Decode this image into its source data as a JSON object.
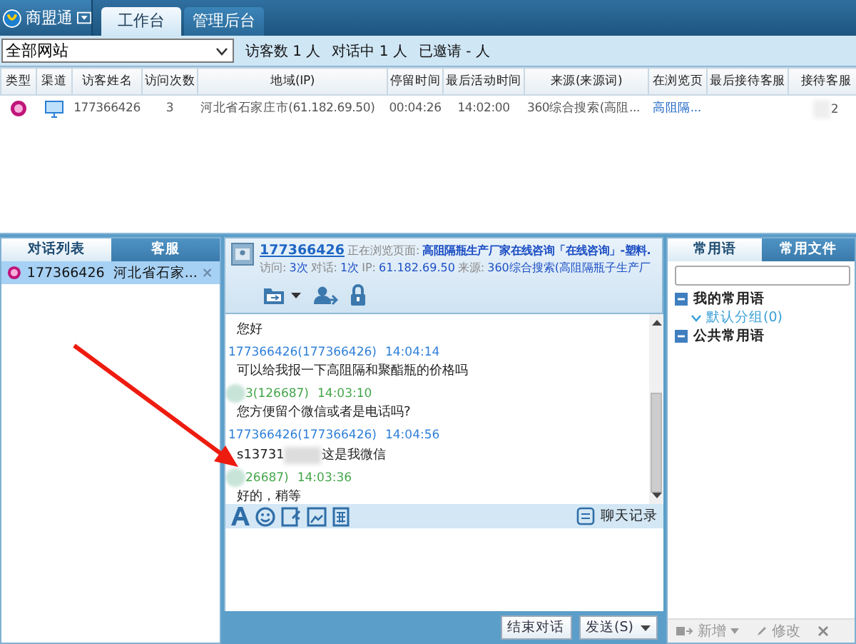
{
  "app": {
    "title": "商盟通"
  },
  "tabs": [
    {
      "label": "工作台",
      "selected": true
    },
    {
      "label": "管理后台",
      "selected": false
    }
  ],
  "filter": {
    "value": "全部网站",
    "stats": [
      "访客数 1 人",
      "对话中 1 人",
      "已邀请 - 人"
    ]
  },
  "table": {
    "columns": [
      "类型",
      "渠道",
      "访客姓名",
      "访问次数",
      "地域(IP)",
      "停留时间",
      "最后活动时间",
      "来源(来源词)",
      "在浏览页",
      "最后接待客服",
      "接待客服"
    ],
    "rows": [
      {
        "cells": [
          "",
          "",
          "177366426",
          "3",
          "河北省石家庄市(61.182.69.50)",
          "00:04:26",
          "14:02:00",
          "360综合搜索(高阻...",
          "高阻隔...",
          "",
          "2"
        ]
      }
    ]
  },
  "left_panel": {
    "tabs": [
      {
        "label": "对话列表",
        "selected": true
      },
      {
        "label": "客服",
        "selected": false
      }
    ],
    "items": [
      {
        "label": "177366426  河北省石家...",
        "selected": true
      }
    ]
  },
  "chat": {
    "visitor": "177366426",
    "browsing_label": "正在浏览页面:",
    "browsing_page": "高阻隔瓶生产厂家在线咨询「在线咨询」-塑料.",
    "stats": [
      {
        "label": "访问:",
        "value": "3次"
      },
      {
        "label": "对话:",
        "value": "1次"
      },
      {
        "label": "IP:",
        "value": "61.182.69.50"
      },
      {
        "label": "来源:",
        "value": "360综合搜索(高阻隔瓶子生产厂"
      }
    ],
    "messages": [
      {
        "kind": "agent",
        "text": "您好"
      },
      {
        "kind": "visitor",
        "sender": "177366426(177366426)",
        "time": "14:04:14",
        "text": "可以给我报一下高阻隔和聚酯瓶的价格吗"
      },
      {
        "kind": "agent",
        "sender": "3(126687)",
        "time": "14:03:10",
        "text": "您方便留个微信或者是电话吗?"
      },
      {
        "kind": "visitor",
        "sender": "177366426(177366426)",
        "time": "14:04:56",
        "text": "s13731",
        "text_after": "这是我微信"
      },
      {
        "kind": "agent",
        "sender": "26687)",
        "time": "14:03:36",
        "text": "好的，稍等"
      }
    ],
    "history_label": "聊天记录",
    "end_button": "结束对话",
    "send_button": "发送(S)"
  },
  "right_panel": {
    "tabs": [
      {
        "label": "常用语",
        "selected": true
      },
      {
        "label": "常用文件",
        "selected": false
      }
    ],
    "tree": [
      {
        "label": "我的常用语",
        "expanded": true,
        "children": [
          {
            "label": "默认分组(0)"
          }
        ]
      },
      {
        "label": "公共常用语",
        "expanded": true
      }
    ],
    "actions": [
      {
        "kind": "add",
        "label": "新增"
      },
      {
        "kind": "edit",
        "label": "修改"
      },
      {
        "kind": "delete"
      }
    ]
  }
}
